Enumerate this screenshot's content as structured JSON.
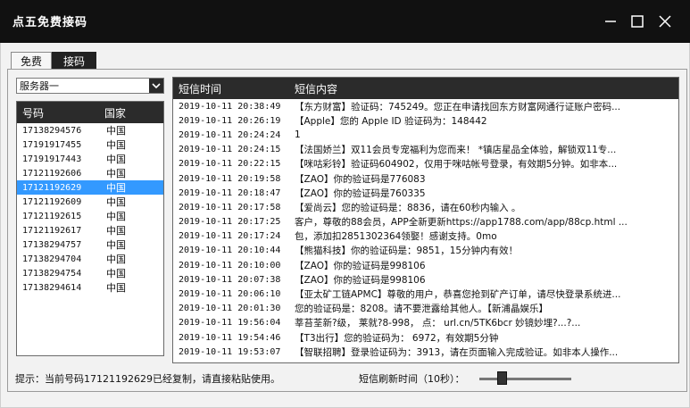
{
  "window": {
    "title": "点五免费接码",
    "icons": {
      "minimize": "minimize-icon",
      "maximize": "maximize-icon",
      "close": "close-icon"
    }
  },
  "tabs": [
    {
      "label": "免费",
      "active": false
    },
    {
      "label": "接码",
      "active": true
    }
  ],
  "server_select": {
    "value": "服务器一",
    "icon": "chevron-down-icon"
  },
  "number_list": {
    "headers": [
      "号码",
      "国家"
    ],
    "rows": [
      {
        "number": "17138294576",
        "country": "中国"
      },
      {
        "number": "17191917455",
        "country": "中国"
      },
      {
        "number": "17191917443",
        "country": "中国"
      },
      {
        "number": "17121192606",
        "country": "中国"
      },
      {
        "number": "17121192629",
        "country": "中国"
      },
      {
        "number": "17121192609",
        "country": "中国"
      },
      {
        "number": "17121192615",
        "country": "中国"
      },
      {
        "number": "17121192617",
        "country": "中国"
      },
      {
        "number": "17138294757",
        "country": "中国"
      },
      {
        "number": "17138294704",
        "country": "中国"
      },
      {
        "number": "17138294754",
        "country": "中国"
      },
      {
        "number": "17138294614",
        "country": "中国"
      }
    ],
    "selected_index": 4,
    "selected_color": "#3399ff"
  },
  "sms_list": {
    "headers": [
      "短信时间",
      "短信内容"
    ],
    "rows": [
      {
        "time": "2019-10-11 20:38:49",
        "content": "【东方财富】验证码：745249。您正在申请找回东方财富网通行证账户密码..."
      },
      {
        "time": "2019-10-11 20:26:19",
        "content": "【Apple】您的 Apple ID 验证码为：148442"
      },
      {
        "time": "2019-10-11 20:24:24",
        "content": "1"
      },
      {
        "time": "2019-10-11 20:24:15",
        "content": "【法国娇兰】双11会员专宠福利为您而来！ *镇店星品全体验，解锁双11专..."
      },
      {
        "time": "2019-10-11 20:22:15",
        "content": "【咪咕彩铃】验证码604902，仅用于咪咕帐号登录，有效期5分钟。如非本..."
      },
      {
        "time": "2019-10-11 20:19:58",
        "content": "【ZAO】你的验证码是776083"
      },
      {
        "time": "2019-10-11 20:18:47",
        "content": "【ZAO】你的验证码是760335"
      },
      {
        "time": "2019-10-11 20:17:58",
        "content": "【爱尚云】您的验证码是：8836，请在60秒内输入 。"
      },
      {
        "time": "2019-10-11 20:17:25",
        "content": "客户，尊敬的88会员，APP全新更新https://app1788.com/app/88cp.html ..."
      },
      {
        "time": "2019-10-11 20:17:24",
        "content": "包，添加扣2851302364领娶！感谢支持。0mo"
      },
      {
        "time": "2019-10-11 20:10:44",
        "content": "【熊猫科技】你的验证码是：9851，15分钟内有效！"
      },
      {
        "time": "2019-10-11 20:10:00",
        "content": "【ZAO】你的验证码是998106"
      },
      {
        "time": "2019-10-11 20:07:38",
        "content": "【ZAO】你的验证码是998106"
      },
      {
        "time": "2019-10-11 20:06:10",
        "content": "【亚太矿工链APMC】尊敬的用户，恭喜您抢到矿产订单，请尽快登录系统进..."
      },
      {
        "time": "2019-10-11 20:01:30",
        "content": "您的验证码是：8208。请不要泄露给其他人。【新浦晶娱乐】"
      },
      {
        "time": "2019-10-11 19:56:04",
        "content": "莘苔荃新?级， 莱就?8-998， 点： url.cn/5TK6bcr 妙镜妙埋?...?..."
      },
      {
        "time": "2019-10-11 19:54:46",
        "content": "【T3出行】您的验证码为： 6972，有效期5分钟"
      },
      {
        "time": "2019-10-11 19:53:07",
        "content": "【智联招聘】登录验证码为：3913，请在页面输入完成验证。如非本人操作..."
      }
    ]
  },
  "status": {
    "hint": "提示：当前号码17121192629已经复制，请直接粘贴使用。",
    "refresh_label": "短信刷新时间（10秒）：",
    "refresh_slider_fraction": 0.22
  },
  "colors": {
    "titlebar": "#111111",
    "header": "#2b2b2b",
    "selection": "#3399ff"
  }
}
